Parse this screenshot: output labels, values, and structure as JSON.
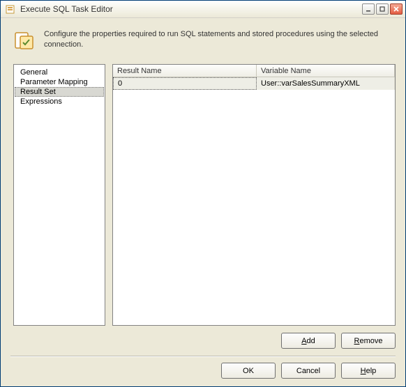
{
  "window": {
    "title": "Execute SQL Task Editor"
  },
  "description": "Configure the properties required to run SQL statements and stored procedures using the selected connection.",
  "nav": {
    "items": [
      {
        "label": "General"
      },
      {
        "label": "Parameter Mapping"
      },
      {
        "label": "Result Set"
      },
      {
        "label": "Expressions"
      }
    ],
    "selected_index": 2
  },
  "grid": {
    "columns": [
      {
        "label": "Result Name"
      },
      {
        "label": "Variable Name"
      }
    ],
    "rows": [
      {
        "result_name": "0",
        "variable_name": "User::varSalesSummaryXML"
      }
    ]
  },
  "buttons": {
    "add": "Add",
    "remove": "Remove",
    "ok": "OK",
    "cancel": "Cancel",
    "help": "Help"
  }
}
